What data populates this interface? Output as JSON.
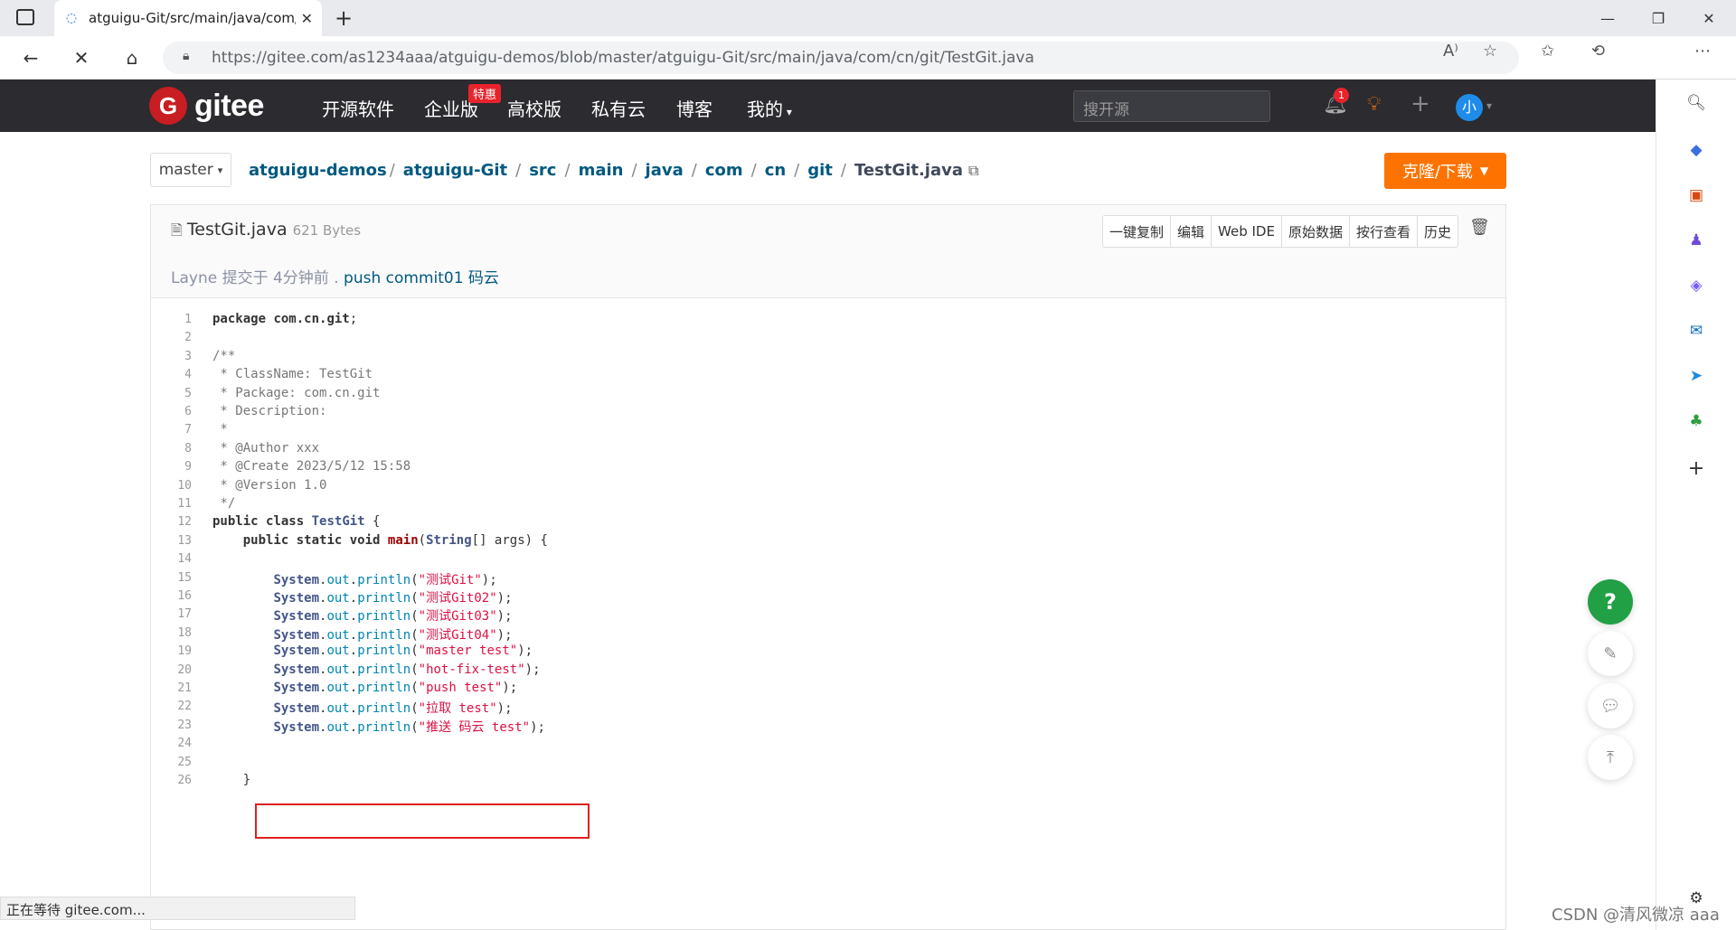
{
  "browser": {
    "tab_title": "atguigu-Git/src/main/java/com/c",
    "url": "https://gitee.com/as1234aaa/atguigu-demos/blob/master/atguigu-Git/src/main/java/com/cn/git/TestGit.java",
    "status": "正在等待 gitee.com..."
  },
  "header": {
    "logo_text": "gitee",
    "nav": [
      "开源软件",
      "企业版",
      "高校版",
      "私有云",
      "博客",
      "我的"
    ],
    "badge": "特惠",
    "search_placeholder": "搜开源",
    "notif_count": "1",
    "avatar": "小"
  },
  "repo": {
    "branch": "master",
    "crumbs": [
      "atguigu-demos",
      "atguigu-Git",
      "src",
      "main",
      "java",
      "com",
      "cn",
      "git"
    ],
    "current_file": "TestGit.java",
    "clone_label": "克隆/下载"
  },
  "file": {
    "name": "TestGit.java",
    "size": "621 Bytes",
    "actions": [
      "一键复制",
      "编辑",
      "Web IDE",
      "原始数据",
      "按行查看",
      "历史"
    ],
    "commit_prefix": "Layne 提交于 4分钟前 .",
    "commit_msg": "push commit01 码云"
  },
  "code": [
    "package com.cn.git;",
    "",
    "/**",
    " * ClassName: TestGit",
    " * Package: com.cn.git",
    " * Description:",
    " *",
    " * @Author xxx",
    " * @Create 2023/5/12 15:58",
    " * @Version 1.0",
    " */",
    "public class TestGit {",
    "    public static void main(String[] args) {",
    "",
    "        System.out.println(\"测试Git\");",
    "        System.out.println(\"测试Git02\");",
    "        System.out.println(\"测试Git03\");",
    "        System.out.println(\"测试Git04\");",
    "        System.out.println(\"master test\");",
    "        System.out.println(\"hot-fix-test\");",
    "        System.out.println(\"push test\");",
    "        System.out.println(\"拉取 test\");",
    "        System.out.println(\"推送 码云 test\");",
    "",
    "",
    "    }"
  ],
  "watermark": "CSDN @清风微凉 aaa",
  "colors": {
    "accent": "#fe7300",
    "brand": "#c71d23",
    "link": "#005980",
    "header_bg": "#2b2b30"
  }
}
